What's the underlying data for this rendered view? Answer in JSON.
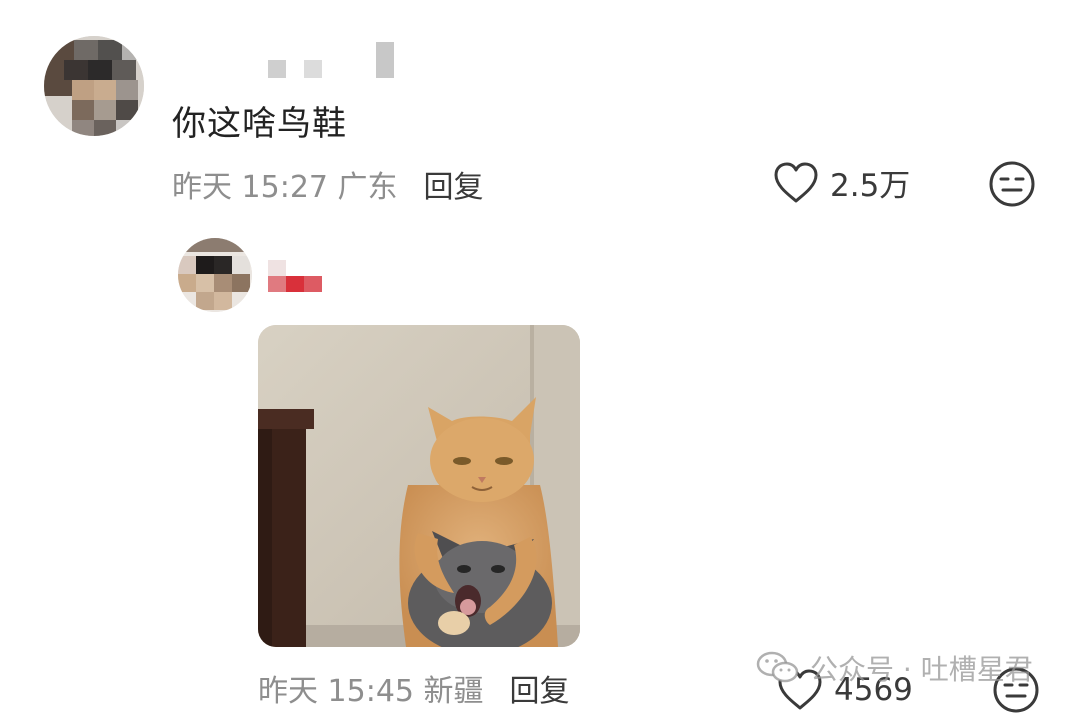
{
  "comment": {
    "text": "你这啥鸟鞋",
    "meta": "昨天 15:27 广东",
    "reply_label": "回复",
    "likes": "2.5万"
  },
  "reply": {
    "meta": "昨天 15:45 新疆",
    "reply_label": "回复",
    "likes": "4569"
  },
  "watermark": {
    "text": "公众号 · 吐槽星君"
  },
  "icons": {
    "like": "heart-outline-icon",
    "dislike": "neutral-face-icon",
    "watermark": "wechat-icon"
  },
  "colors": {
    "meta_text": "#8e8e8e",
    "body_text": "#222222",
    "name_tag": "#d9303a"
  }
}
